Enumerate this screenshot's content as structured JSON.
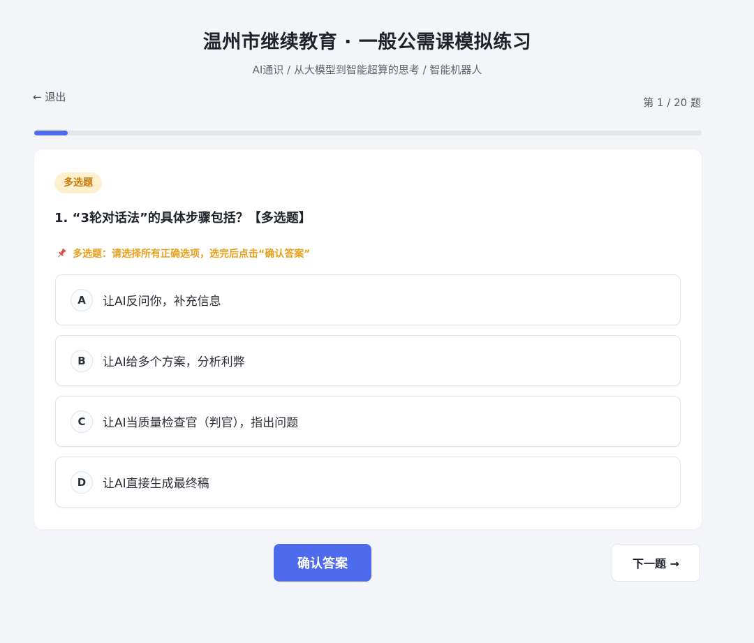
{
  "header": {
    "title": "温州市继续教育 · 一般公需课模拟练习",
    "breadcrumb": "AI通识 / 从大模型到智能超算的思考 / 智能机器人"
  },
  "nav": {
    "exit_label": "← 退出",
    "counter": "第 1 / 20 题"
  },
  "progress": {
    "value": 0.05,
    "fill_color": "#4f6bed"
  },
  "question": {
    "type_badge": "多选题",
    "text": "1. “3轮对话法”的具体步骤包括？【多选题】",
    "hint": "多选题：请选择所有正确选项，选完后点击“确认答案”",
    "hint_icon": "pushpin-icon",
    "options": [
      {
        "letter": "A",
        "text": "让AI反问你，补充信息"
      },
      {
        "letter": "B",
        "text": "让AI给多个方案，分析利弊"
      },
      {
        "letter": "C",
        "text": "让AI当质量检查官（判官），指出问题"
      },
      {
        "letter": "D",
        "text": "让AI直接生成最终稿"
      }
    ]
  },
  "actions": {
    "confirm_label": "确认答案",
    "next_label": "下一题 →"
  },
  "colors": {
    "accent": "#4f6bed",
    "badge_bg": "#fdf0cf",
    "badge_text": "#c67a0a",
    "hint_text": "#e6a11f"
  }
}
